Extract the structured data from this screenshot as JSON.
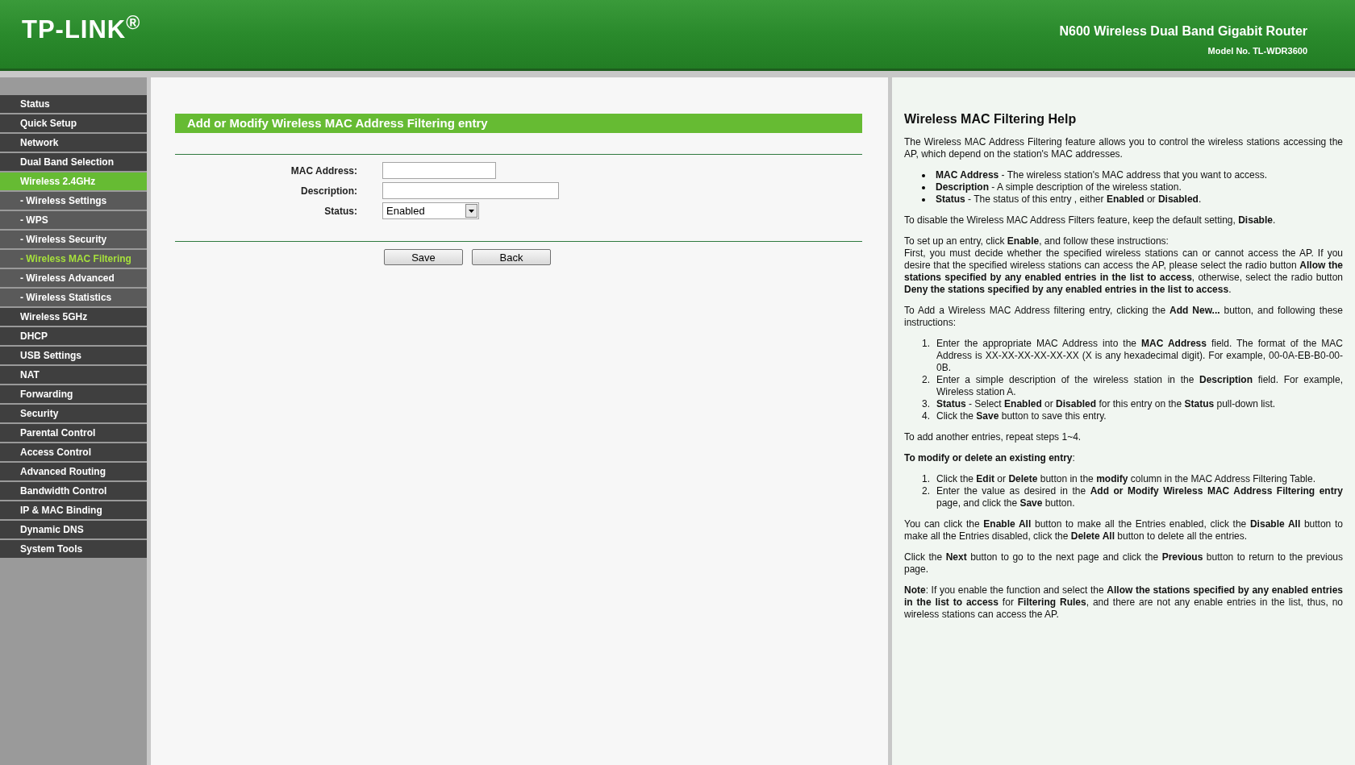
{
  "header": {
    "logo": "TP-LINK$^{®}$",
    "product": "N600 Wireless Dual Band Gigabit Router",
    "model": "Model No. TL-WDR3600"
  },
  "sidebar": {
    "items": [
      {
        "label": "Status",
        "kind": "main",
        "selected": false
      },
      {
        "label": "Quick Setup",
        "kind": "main",
        "selected": false
      },
      {
        "label": "Network",
        "kind": "main",
        "selected": false
      },
      {
        "label": "Dual Band Selection",
        "kind": "main",
        "selected": false
      },
      {
        "label": "Wireless 2.4GHz",
        "kind": "main",
        "selected": true
      },
      {
        "label": "- Wireless Settings",
        "kind": "sub",
        "selected": false
      },
      {
        "label": "- WPS",
        "kind": "sub",
        "selected": false
      },
      {
        "label": "- Wireless Security",
        "kind": "sub",
        "selected": false
      },
      {
        "label": "- Wireless MAC Filtering",
        "kind": "sub",
        "selected": true
      },
      {
        "label": "- Wireless Advanced",
        "kind": "sub",
        "selected": false
      },
      {
        "label": "- Wireless Statistics",
        "kind": "sub",
        "selected": false
      },
      {
        "label": "Wireless 5GHz",
        "kind": "main",
        "selected": false
      },
      {
        "label": "DHCP",
        "kind": "main",
        "selected": false
      },
      {
        "label": "USB Settings",
        "kind": "main",
        "selected": false
      },
      {
        "label": "NAT",
        "kind": "main",
        "selected": false
      },
      {
        "label": "Forwarding",
        "kind": "main",
        "selected": false
      },
      {
        "label": "Security",
        "kind": "main",
        "selected": false
      },
      {
        "label": "Parental Control",
        "kind": "main",
        "selected": false
      },
      {
        "label": "Access Control",
        "kind": "main",
        "selected": false
      },
      {
        "label": "Advanced Routing",
        "kind": "main",
        "selected": false
      },
      {
        "label": "Bandwidth Control",
        "kind": "main",
        "selected": false
      },
      {
        "label": "IP & MAC Binding",
        "kind": "main",
        "selected": false
      },
      {
        "label": "Dynamic DNS",
        "kind": "main",
        "selected": false
      },
      {
        "label": "System Tools",
        "kind": "main",
        "selected": false
      }
    ]
  },
  "form": {
    "title": "Add or Modify Wireless MAC Address Filtering entry",
    "fields": [
      {
        "label": "MAC Address:",
        "kind": "short_text"
      },
      {
        "label": "Description:",
        "kind": "long_text"
      },
      {
        "label": "Status:",
        "kind": "select",
        "value": "Enabled"
      }
    ],
    "buttons": [
      "Save",
      "Back"
    ]
  },
  "help": {
    "title": "Wireless MAC Filtering Help",
    "blocks": [
      {
        "kind": "para",
        "lines": [
          "The Wireless MAC Address Filtering feature allows you to control the wireless stations accessing the AP, which depend on the station's MAC addresses."
        ]
      },
      {
        "kind": "bullets",
        "items": [
          "**MAC Address** - The wireless station's MAC address that you want to access.",
          "**Description** - A simple description of the wireless station.",
          "**Status** - The status of this entry , either **Enabled** or **Disabled**."
        ]
      },
      {
        "kind": "para",
        "lines": [
          "To disable the Wireless MAC Address Filters feature, keep the default setting, **Disable**."
        ]
      },
      {
        "kind": "para",
        "lines": [
          "To set up an entry, click **Enable**, and follow these instructions:",
          "First, you must decide whether the specified wireless stations can or cannot access the AP. If you desire that the specified wireless stations can access the AP, please select the radio button **Allow the stations specified by any enabled entries in the list to access**, otherwise, select the radio button **Deny the stations specified by any enabled entries in the list to access**."
        ]
      },
      {
        "kind": "para",
        "lines": [
          "To Add a Wireless MAC Address filtering entry, clicking the **Add New...** button, and following these instructions:"
        ]
      },
      {
        "kind": "steps",
        "items": [
          {
            "number": "1.",
            "text": "Enter the appropriate MAC Address into the **MAC Address** field. The format of the MAC Address is XX-XX-XX-XX-XX-XX (X is any hexadecimal digit). For example, 00-0A-EB-B0-00-0B."
          },
          {
            "number": "2.",
            "text": "Enter a simple description of the wireless station in the **Description** field. For example, Wireless station A."
          },
          {
            "number": "3.",
            "text": "**Status** - Select **Enabled** or **Disabled** for this entry on the **Status** pull-down list."
          },
          {
            "number": "4.",
            "text": "Click the **Save** button to save this entry."
          }
        ]
      },
      {
        "kind": "para",
        "lines": [
          "To add another entries, repeat steps 1~4."
        ]
      },
      {
        "kind": "para",
        "lines": [
          "**To modify or delete an existing entry**:"
        ]
      },
      {
        "kind": "steps",
        "items": [
          {
            "number": "1.",
            "text": "Click the **Edit** or **Delete** button in the **modify** column in the MAC Address Filtering Table."
          },
          {
            "number": "2.",
            "text": "Enter the value as desired in the **Add or Modify Wireless MAC Address Filtering entry** page, and click the **Save** button."
          }
        ]
      },
      {
        "kind": "para",
        "lines": [
          "You can click the **Enable All** button to make all the Entries enabled, click the **Disable All** button to make all the Entries disabled, click the **Delete All** button to delete all the entries."
        ]
      },
      {
        "kind": "para",
        "lines": [
          "Click the **Next** button to go to the next page and click the **Previous** button to return to the previous page."
        ]
      },
      {
        "kind": "para",
        "lines": [
          "**Note**: If you enable the function and select the **Allow the stations specified by any enabled entries in the list to access** for **Filtering Rules**, and there are not any enable entries in the list, thus, no wireless stations can access the AP."
        ]
      }
    ]
  }
}
